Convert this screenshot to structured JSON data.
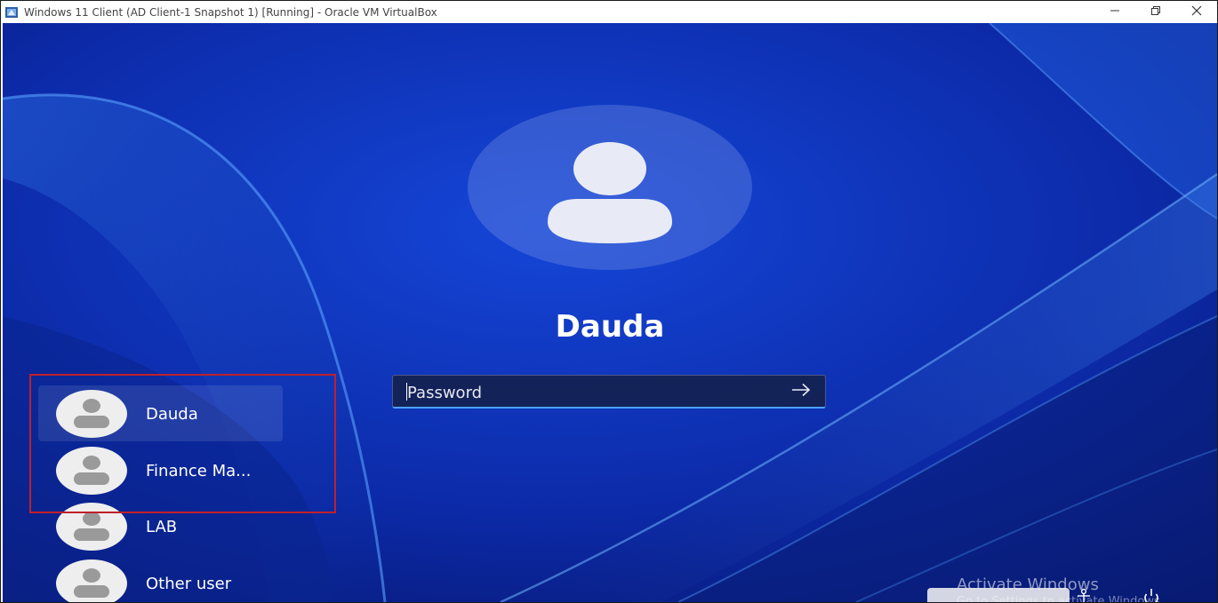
{
  "window": {
    "title": "Windows 11 Client (AD Client-1 Snapshot 1) [Running] - Oracle VM VirtualBox",
    "app_icon": "virtualbox-icon",
    "controls": [
      "minimize-icon",
      "restore-icon",
      "close-icon"
    ]
  },
  "login": {
    "selected_user": "Dauda",
    "avatar_icon": "user-icon",
    "password_placeholder": "Password",
    "password_value": "",
    "submit_icon": "arrow-right-icon",
    "field_accent": "#4aa3ff"
  },
  "users": [
    {
      "name": "Dauda",
      "selected": true
    },
    {
      "name": "Finance Ma...",
      "selected": false
    },
    {
      "name": "LAB",
      "selected": false
    },
    {
      "name": "Other user",
      "selected": false
    }
  ],
  "watermark": {
    "title": "Activate Windows",
    "subtitle": "Go to Settings to activate Windows."
  },
  "tray": {
    "icons": [
      "accessibility-icon",
      "power-icon"
    ]
  },
  "colors": {
    "wallpaper_base": "#0d2a9a",
    "annotation_box": "#c0202a"
  }
}
